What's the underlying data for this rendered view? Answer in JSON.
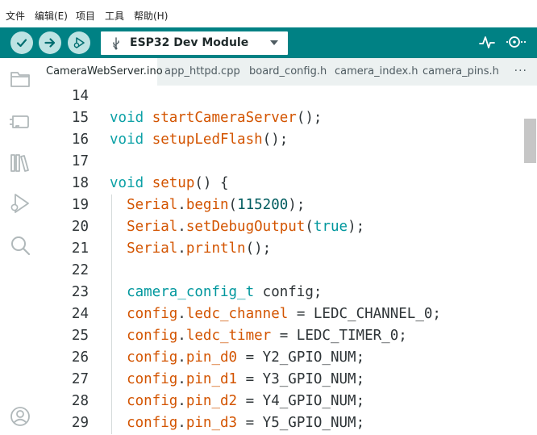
{
  "menu": [
    "文件",
    "编辑(E)",
    "项目",
    "工具",
    "帮助(H)"
  ],
  "toolbar": {
    "verify_icon": "check-icon",
    "upload_icon": "arrow-right-icon",
    "debug_icon": "debug-icon",
    "board_name": "ESP32 Dev Module",
    "usb_icon": "usb-icon",
    "serial_plotter_icon": "plotter-icon",
    "serial_monitor_icon": "monitor-icon",
    "accent": "#008184"
  },
  "sidebar": [
    "folder-icon",
    "board-icon",
    "library-icon",
    "debug-icon",
    "search-icon",
    "account-icon"
  ],
  "tabs": [
    "CameraWebServer.ino",
    "app_httpd.cpp",
    "board_config.h",
    "camera_index.h",
    "camera_pins.h"
  ],
  "tabs_more": "···",
  "active_tab": "CameraWebServer.ino",
  "code_lines": [
    {
      "n": "14",
      "tokens": []
    },
    {
      "n": "15",
      "tokens": [
        [
          "kw",
          "void"
        ],
        [
          "plain",
          " "
        ],
        [
          "fn",
          "startCameraServer"
        ],
        [
          "plain",
          "();"
        ]
      ]
    },
    {
      "n": "16",
      "tokens": [
        [
          "kw",
          "void"
        ],
        [
          "plain",
          " "
        ],
        [
          "fn",
          "setupLedFlash"
        ],
        [
          "plain",
          "();"
        ]
      ]
    },
    {
      "n": "17",
      "tokens": []
    },
    {
      "n": "18",
      "tokens": [
        [
          "kw",
          "void"
        ],
        [
          "plain",
          " "
        ],
        [
          "fn",
          "setup"
        ],
        [
          "plain",
          "() {"
        ]
      ]
    },
    {
      "n": "19",
      "tokens": [
        [
          "plain",
          "  "
        ],
        [
          "cls",
          "Serial"
        ],
        [
          "plain",
          "."
        ],
        [
          "fn",
          "begin"
        ],
        [
          "plain",
          "("
        ],
        [
          "num",
          "115200"
        ],
        [
          "plain",
          ");"
        ]
      ]
    },
    {
      "n": "20",
      "tokens": [
        [
          "plain",
          "  "
        ],
        [
          "cls",
          "Serial"
        ],
        [
          "plain",
          "."
        ],
        [
          "fn",
          "setDebugOutput"
        ],
        [
          "plain",
          "("
        ],
        [
          "lit",
          "true"
        ],
        [
          "plain",
          ");"
        ]
      ]
    },
    {
      "n": "21",
      "tokens": [
        [
          "plain",
          "  "
        ],
        [
          "cls",
          "Serial"
        ],
        [
          "plain",
          "."
        ],
        [
          "fn",
          "println"
        ],
        [
          "plain",
          "();"
        ]
      ]
    },
    {
      "n": "22",
      "tokens": []
    },
    {
      "n": "23",
      "tokens": [
        [
          "plain",
          "  "
        ],
        [
          "typ",
          "camera_config_t"
        ],
        [
          "plain",
          " config;"
        ]
      ]
    },
    {
      "n": "24",
      "tokens": [
        [
          "plain",
          "  "
        ],
        [
          "fn",
          "config"
        ],
        [
          "plain",
          "."
        ],
        [
          "fn",
          "ledc_channel"
        ],
        [
          "plain",
          " = LEDC_CHANNEL_0;"
        ]
      ]
    },
    {
      "n": "25",
      "tokens": [
        [
          "plain",
          "  "
        ],
        [
          "fn",
          "config"
        ],
        [
          "plain",
          "."
        ],
        [
          "fn",
          "ledc_timer"
        ],
        [
          "plain",
          " = LEDC_TIMER_0;"
        ]
      ]
    },
    {
      "n": "26",
      "tokens": [
        [
          "plain",
          "  "
        ],
        [
          "fn",
          "config"
        ],
        [
          "plain",
          "."
        ],
        [
          "fn",
          "pin_d0"
        ],
        [
          "plain",
          " = Y2_GPIO_NUM;"
        ]
      ]
    },
    {
      "n": "27",
      "tokens": [
        [
          "plain",
          "  "
        ],
        [
          "fn",
          "config"
        ],
        [
          "plain",
          "."
        ],
        [
          "fn",
          "pin_d1"
        ],
        [
          "plain",
          " = Y3_GPIO_NUM;"
        ]
      ]
    },
    {
      "n": "28",
      "tokens": [
        [
          "plain",
          "  "
        ],
        [
          "fn",
          "config"
        ],
        [
          "plain",
          "."
        ],
        [
          "fn",
          "pin_d2"
        ],
        [
          "plain",
          " = Y4_GPIO_NUM;"
        ]
      ]
    },
    {
      "n": "29",
      "tokens": [
        [
          "plain",
          "  "
        ],
        [
          "fn",
          "config"
        ],
        [
          "plain",
          "."
        ],
        [
          "fn",
          "pin_d3"
        ],
        [
          "plain",
          " = Y5_GPIO_NUM;"
        ]
      ]
    }
  ]
}
